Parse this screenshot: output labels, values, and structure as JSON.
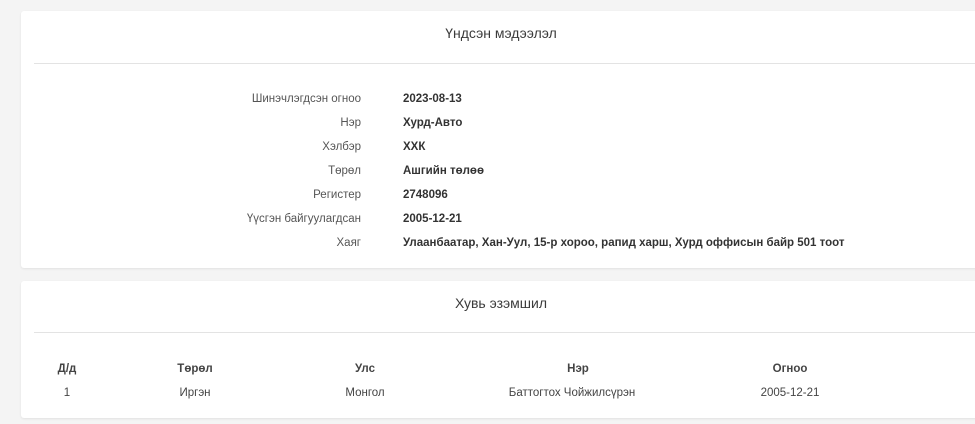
{
  "basic_info": {
    "title": "Үндсэн мэдээлэл",
    "rows": [
      {
        "label": "Шинэчлэгдсэн огноо",
        "value": "2023-08-13"
      },
      {
        "label": "Нэр",
        "value": "Хурд-Авто"
      },
      {
        "label": "Хэлбэр",
        "value": "ХХК"
      },
      {
        "label": "Төрөл",
        "value": "Ашгийн төлөө"
      },
      {
        "label": "Регистер",
        "value": "2748096"
      },
      {
        "label": "Үүсгэн байгуулагдсан",
        "value": "2005-12-21"
      },
      {
        "label": "Хаяг",
        "value": "Улаанбаатар, Хан-Уул, 15-р хороо, рапид харш, Хурд оффисын байр 501 тоот"
      }
    ]
  },
  "ownership": {
    "title": "Хувь эзэмшил",
    "columns": [
      "Д/д",
      "Төрөл",
      "Улс",
      "Нэр",
      "Огноо"
    ],
    "rows": [
      [
        "1",
        "Иргэн",
        "Монгол",
        "Баттогтох Чойжилсүрэн",
        "2005-12-21"
      ]
    ]
  }
}
